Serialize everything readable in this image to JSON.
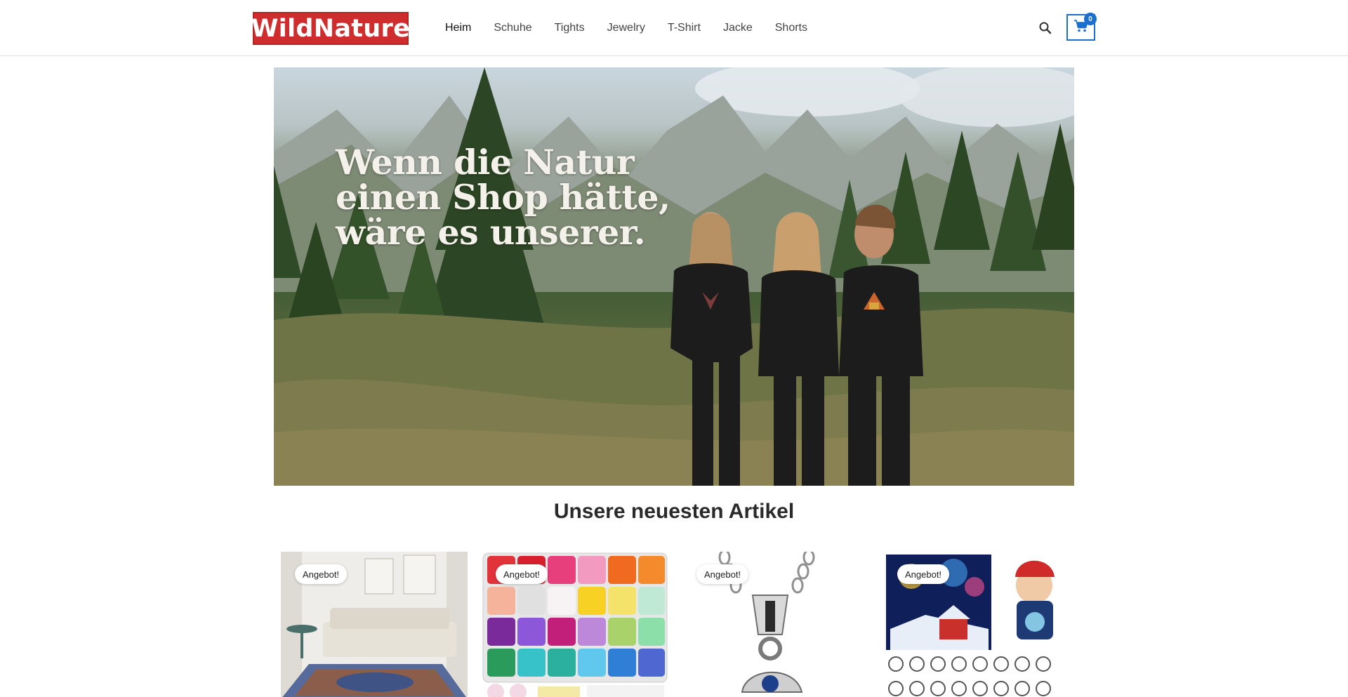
{
  "brand": {
    "logo_text": "WildNature",
    "logo_color": "#cf2d2d"
  },
  "nav": {
    "items": [
      {
        "label": "Heim",
        "active": true
      },
      {
        "label": "Schuhe",
        "active": false
      },
      {
        "label": "Tights",
        "active": false
      },
      {
        "label": "Jewelry",
        "active": false
      },
      {
        "label": "T-Shirt",
        "active": false
      },
      {
        "label": "Jacke",
        "active": false
      },
      {
        "label": "Shorts",
        "active": false
      }
    ]
  },
  "header_actions": {
    "search_icon": "search-icon",
    "cart_icon": "shopping-cart-icon",
    "cart_count": "0",
    "accent_color": "#1a6fd1"
  },
  "hero": {
    "headline_line1": "Wenn die Natur",
    "headline_line2": "einen Shop hätte,",
    "headline_line3": "wäre es unserer."
  },
  "section": {
    "title": "Unsere neuesten Artikel"
  },
  "products": [
    {
      "badge": "Angebot!",
      "image": "rug-living-room"
    },
    {
      "badge": "Angebot!",
      "image": "seed-beads-box"
    },
    {
      "badge": "Angebot!",
      "image": "pendant-necklace"
    },
    {
      "badge": "Angebot!",
      "image": "advent-calendar-puzzles"
    }
  ]
}
